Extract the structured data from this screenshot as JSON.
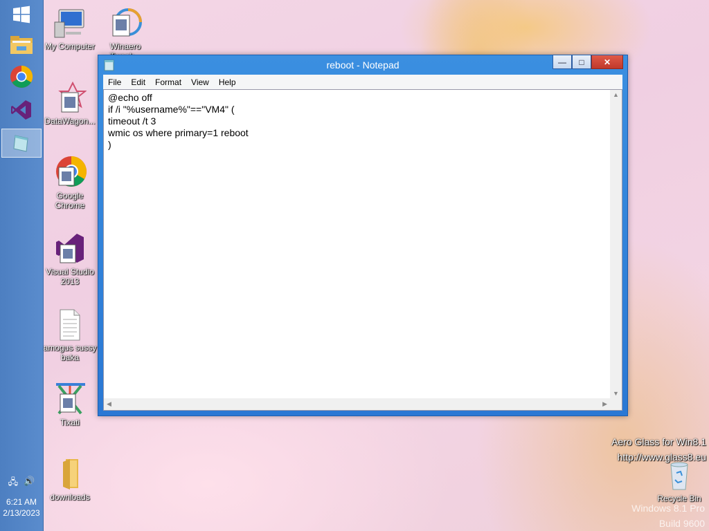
{
  "taskbar": {
    "items": [
      {
        "name": "start-button",
        "icon": "windows-logo-icon"
      },
      {
        "name": "file-explorer",
        "icon": "folder-icon"
      },
      {
        "name": "chrome",
        "icon": "chrome-icon"
      },
      {
        "name": "visual-studio",
        "icon": "visual-studio-icon"
      },
      {
        "name": "notepad",
        "icon": "notepad-icon",
        "active": true
      }
    ],
    "clock": {
      "time": "6:21 AM",
      "date": "2/13/2023"
    }
  },
  "desktop": {
    "icons": [
      {
        "label": "My Computer",
        "icon": "computer-icon"
      },
      {
        "label": "Winaero Tweak...",
        "icon": "shortcut-icon"
      },
      {
        "label": "DataWagon...",
        "icon": "shortcut-icon"
      },
      {
        "label": "Google Chrome",
        "icon": "chrome-icon"
      },
      {
        "label": "Visual Studio 2013",
        "icon": "visual-studio-icon"
      },
      {
        "label": "amogus sussy baka",
        "icon": "text-file-icon"
      },
      {
        "label": "Tixati",
        "icon": "shortcut-icon"
      },
      {
        "label": "downloads",
        "icon": "folder-icon"
      },
      {
        "label": "Recycle Bin",
        "icon": "recycle-bin-icon"
      }
    ]
  },
  "window": {
    "title": "reboot - Notepad",
    "menu": [
      "File",
      "Edit",
      "Format",
      "View",
      "Help"
    ],
    "content": "@echo off\nif /i \"%username%\"==\"VM4\" (\ntimeout /t 3\nwmic os where primary=1 reboot\n)",
    "buttons": {
      "minimize": "—",
      "maximize": "□",
      "close": "✕"
    }
  },
  "watermark": {
    "line1": "Aero Glass for Win8.1",
    "line2": "http://www.glass8.eu",
    "line3": "Windows 8.1 Pro",
    "line4": "Build 9600"
  },
  "colors": {
    "taskbar": "#5a8ccd",
    "window_frame": "#2a78d4",
    "close_button": "#c0392b"
  }
}
